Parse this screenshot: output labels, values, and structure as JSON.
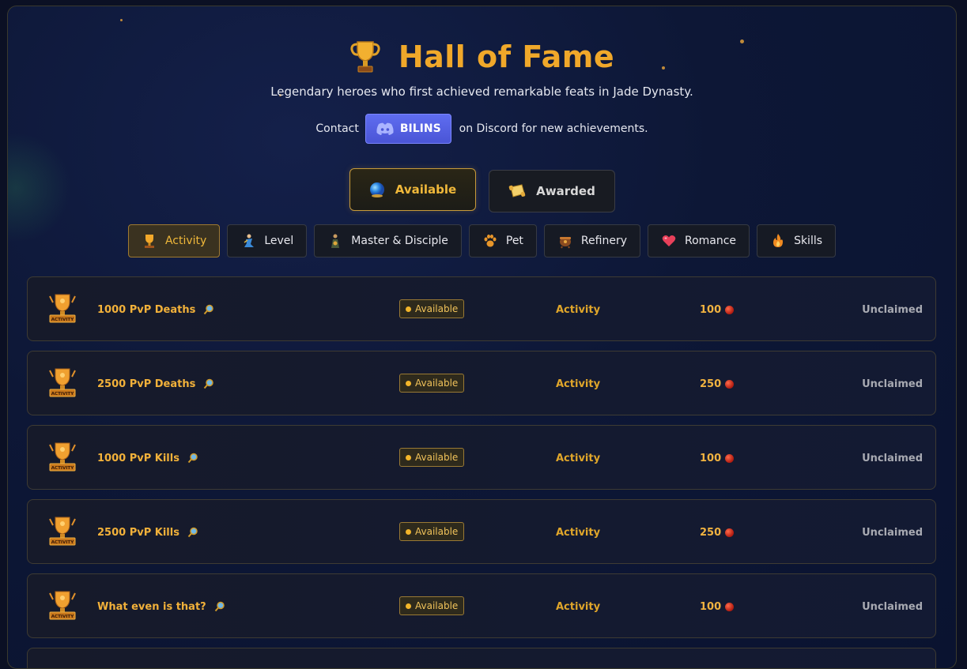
{
  "header": {
    "title": "Hall of Fame",
    "subtitle": "Legendary heroes who first achieved remarkable feats in Jade Dynasty.",
    "contact_prefix": "Contact",
    "discord_name": "BILINS",
    "contact_suffix": "on Discord for new achievements."
  },
  "main_tabs": [
    {
      "label": "Available",
      "icon": "orb-icon",
      "active": true
    },
    {
      "label": "Awarded",
      "icon": "scroll-icon",
      "active": false
    }
  ],
  "sub_tabs": [
    {
      "label": "Activity",
      "icon": "trophy-icon",
      "active": true
    },
    {
      "label": "Level",
      "icon": "character-icon"
    },
    {
      "label": "Master & Disciple",
      "icon": "master-icon"
    },
    {
      "label": "Pet",
      "icon": "paw-icon"
    },
    {
      "label": "Refinery",
      "icon": "cauldron-icon"
    },
    {
      "label": "Romance",
      "icon": "heart-icon"
    },
    {
      "label": "Skills",
      "icon": "flame-icon"
    }
  ],
  "badge_text": "ACTIVITY",
  "achievements": [
    {
      "name": "1000 PvP Deaths",
      "status": "Available",
      "category": "Activity",
      "points": "100",
      "claim": "Unclaimed"
    },
    {
      "name": "2500 PvP Deaths",
      "status": "Available",
      "category": "Activity",
      "points": "250",
      "claim": "Unclaimed"
    },
    {
      "name": "1000 PvP Kills",
      "status": "Available",
      "category": "Activity",
      "points": "100",
      "claim": "Unclaimed"
    },
    {
      "name": "2500 PvP Kills",
      "status": "Available",
      "category": "Activity",
      "points": "250",
      "claim": "Unclaimed"
    },
    {
      "name": "What even is that?",
      "status": "Available",
      "category": "Activity",
      "points": "100",
      "claim": "Unclaimed"
    }
  ],
  "colors": {
    "accent": "#f0a82a",
    "discord": "#5865f2",
    "background": "#0d1736"
  }
}
